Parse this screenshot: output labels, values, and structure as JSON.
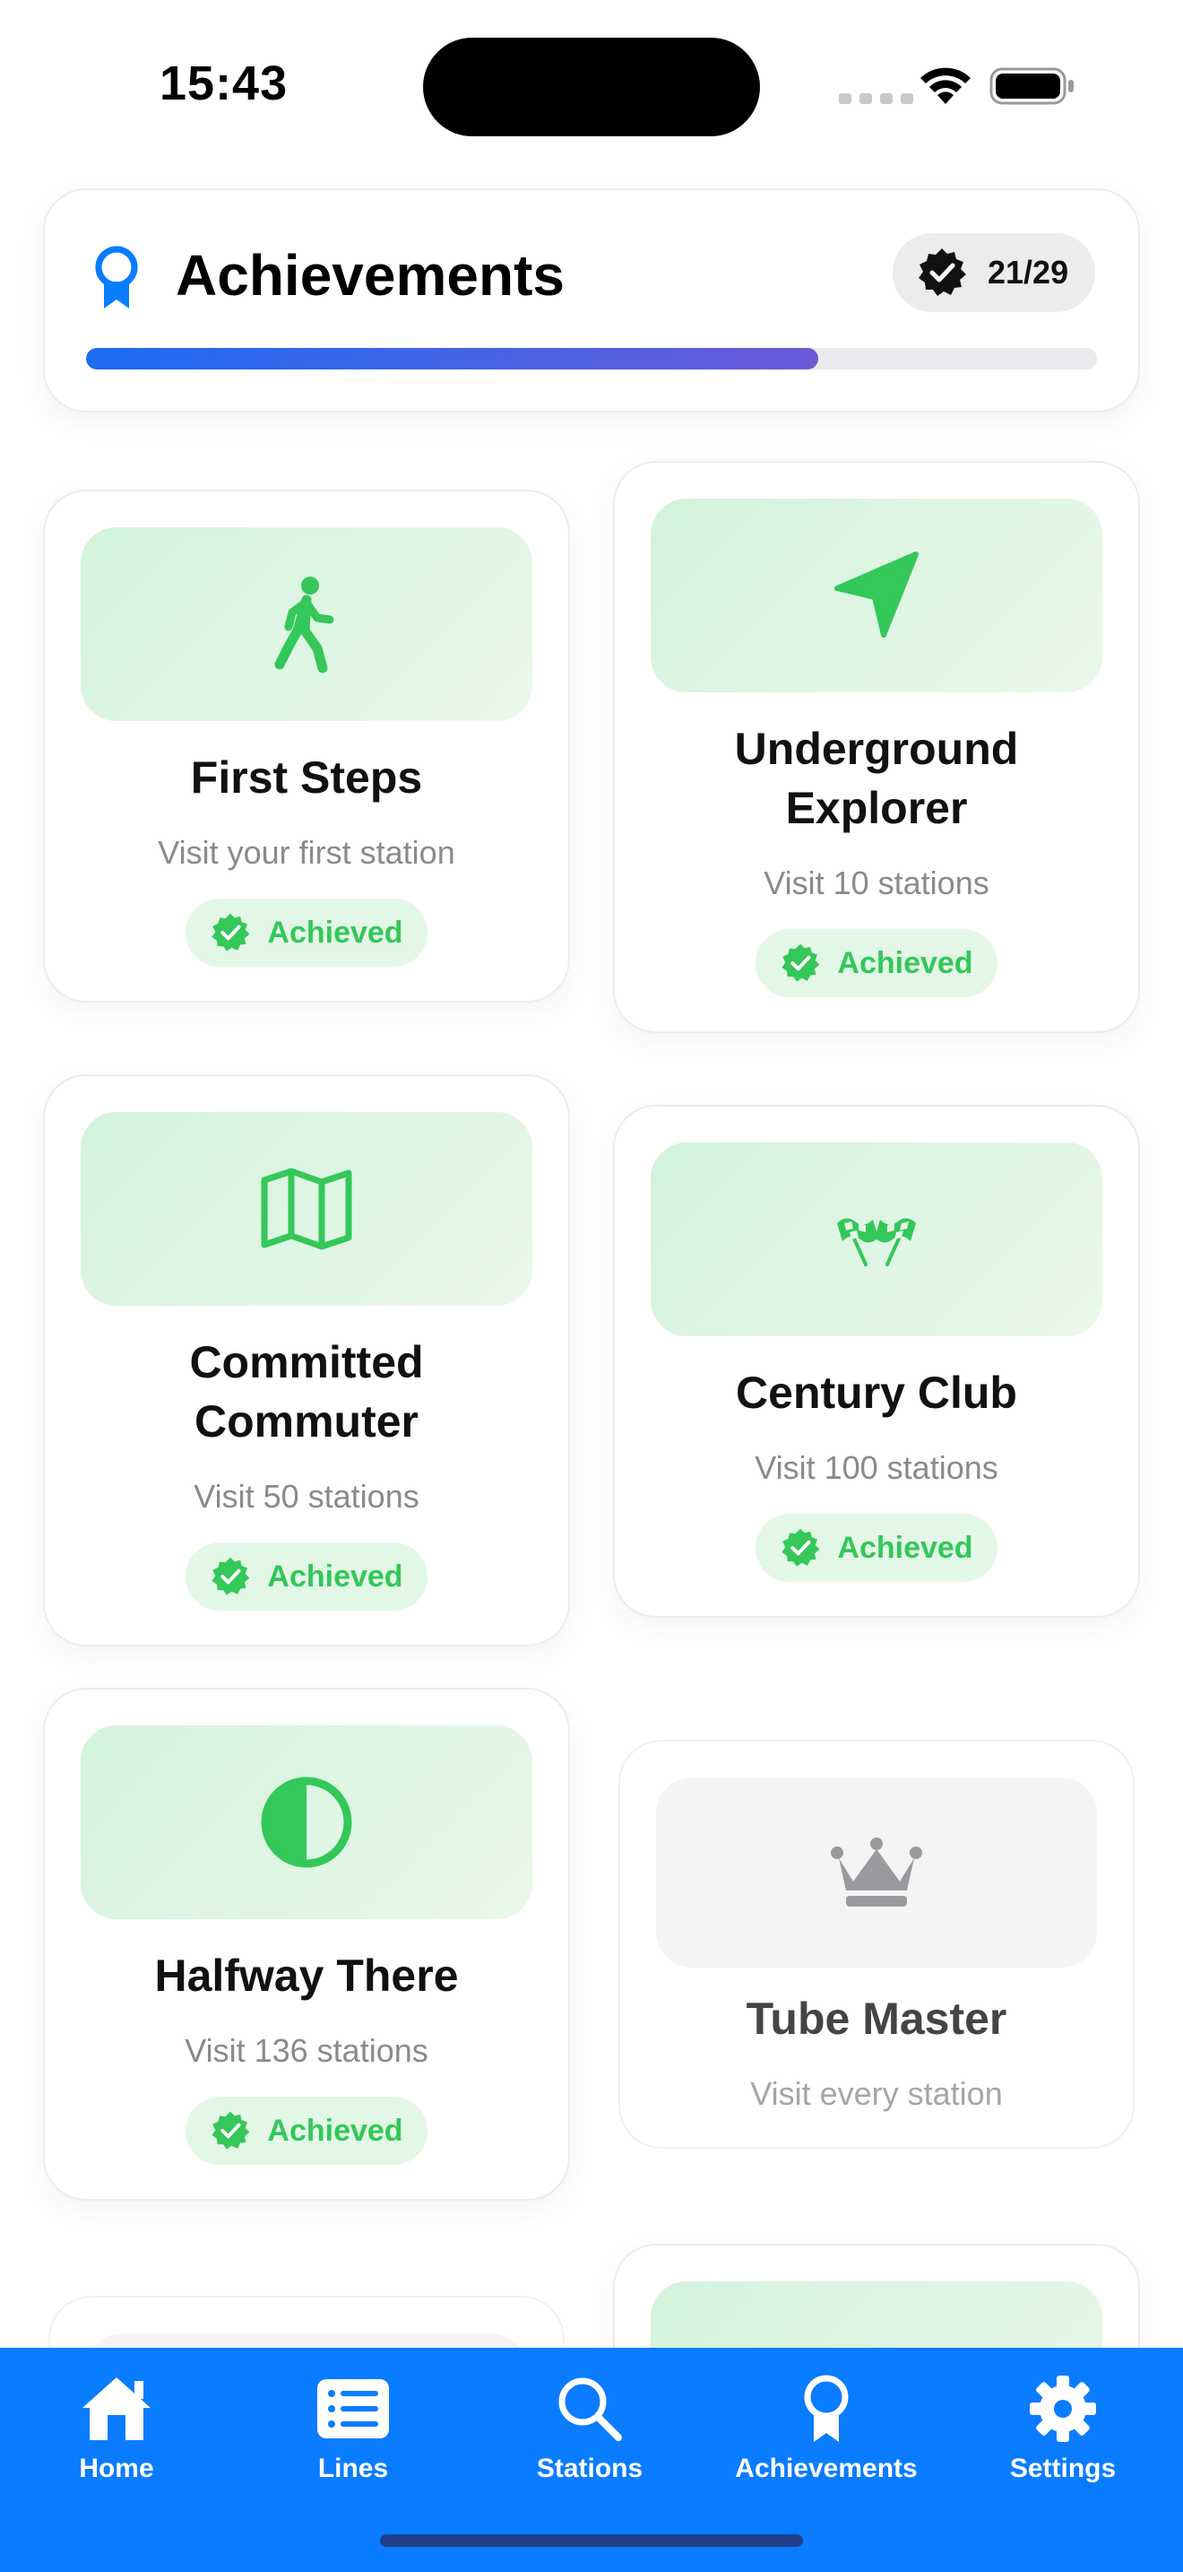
{
  "status_bar": {
    "time": "15:43"
  },
  "header": {
    "title": "Achievements",
    "count": "21/29",
    "progress": 0.724
  },
  "colors": {
    "accent": "#0a7cff",
    "success": "#34c759",
    "locked": "#9a9a9e"
  },
  "achievements": [
    {
      "title": "First Steps",
      "description": "Visit your first station",
      "status": "Achieved",
      "icon": "walking-person-icon"
    },
    {
      "title": "Underground Explorer",
      "description": "Visit 10 stations",
      "status": "Achieved",
      "icon": "location-arrow-icon"
    },
    {
      "title": "Committed Commuter",
      "description": "Visit 50 stations",
      "status": "Achieved",
      "icon": "map-icon"
    },
    {
      "title": "Century Club",
      "description": "Visit 100 stations",
      "status": "Achieved",
      "icon": "checkered-flags-icon"
    },
    {
      "title": "Halfway There",
      "description": "Visit 136 stations",
      "status": "Achieved",
      "icon": "half-circle-icon"
    },
    {
      "title": "Tube Master",
      "description": "Visit every station",
      "status": "",
      "icon": "crown-icon"
    }
  ],
  "tabs": [
    {
      "label": "Home",
      "icon": "home-icon"
    },
    {
      "label": "Lines",
      "icon": "list-icon"
    },
    {
      "label": "Stations",
      "icon": "search-icon"
    },
    {
      "label": "Achievements",
      "icon": "award-icon"
    },
    {
      "label": "Settings",
      "icon": "gear-icon"
    }
  ]
}
